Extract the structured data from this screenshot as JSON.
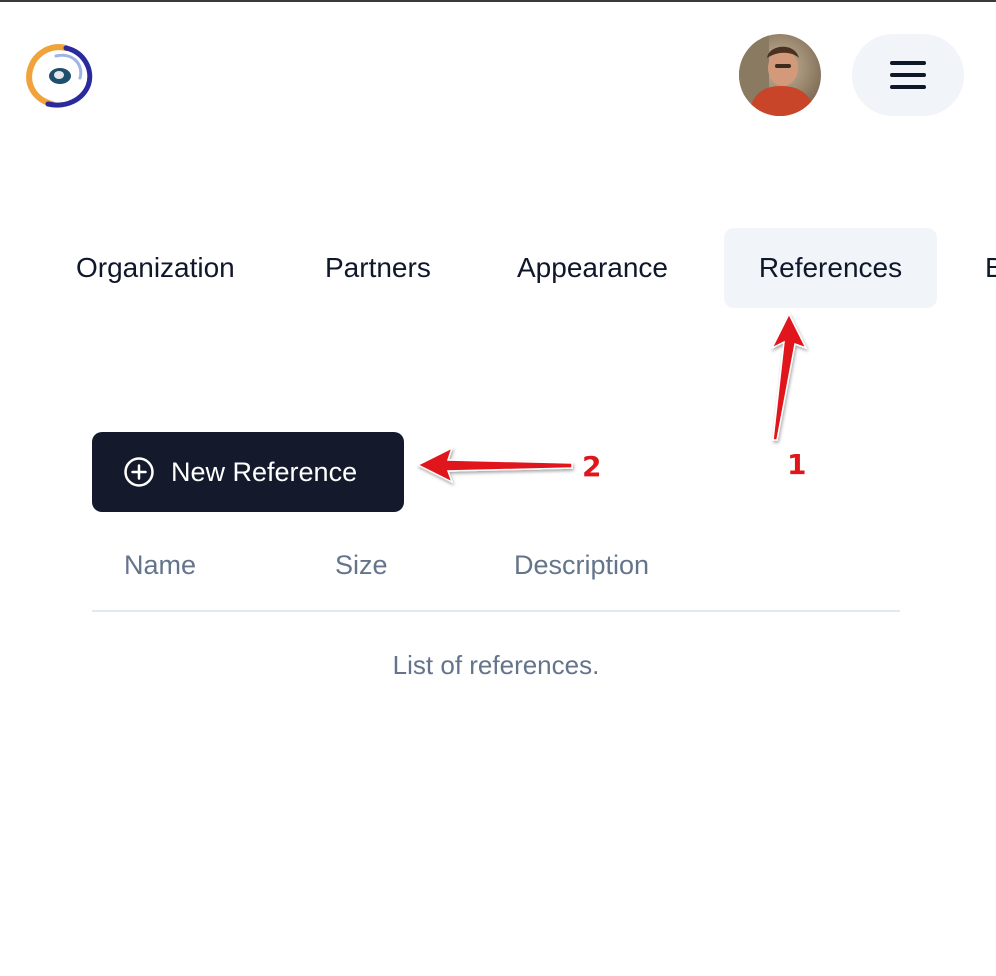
{
  "header": {
    "logo_icon": "app-logo-icon",
    "avatar_icon": "user-avatar",
    "menu_icon": "hamburger-menu-icon"
  },
  "tabs": [
    {
      "label": "Organization"
    },
    {
      "label": "Partners"
    },
    {
      "label": "Appearance"
    },
    {
      "label": "References",
      "active": true
    },
    {
      "label": "B"
    }
  ],
  "actions": {
    "new_reference_label": "New Reference",
    "new_reference_icon": "plus-circle-icon"
  },
  "table": {
    "columns": [
      "Name",
      "Size",
      "Description"
    ],
    "empty_caption": "List of references."
  },
  "annotations": {
    "step_1": "1",
    "step_2": "2",
    "arrow_color": "#e0161b"
  },
  "colors": {
    "primary_button": "#141a2c",
    "active_tab_bg": "#f1f4f8",
    "muted_text": "#64748b",
    "text": "#0f172a"
  }
}
